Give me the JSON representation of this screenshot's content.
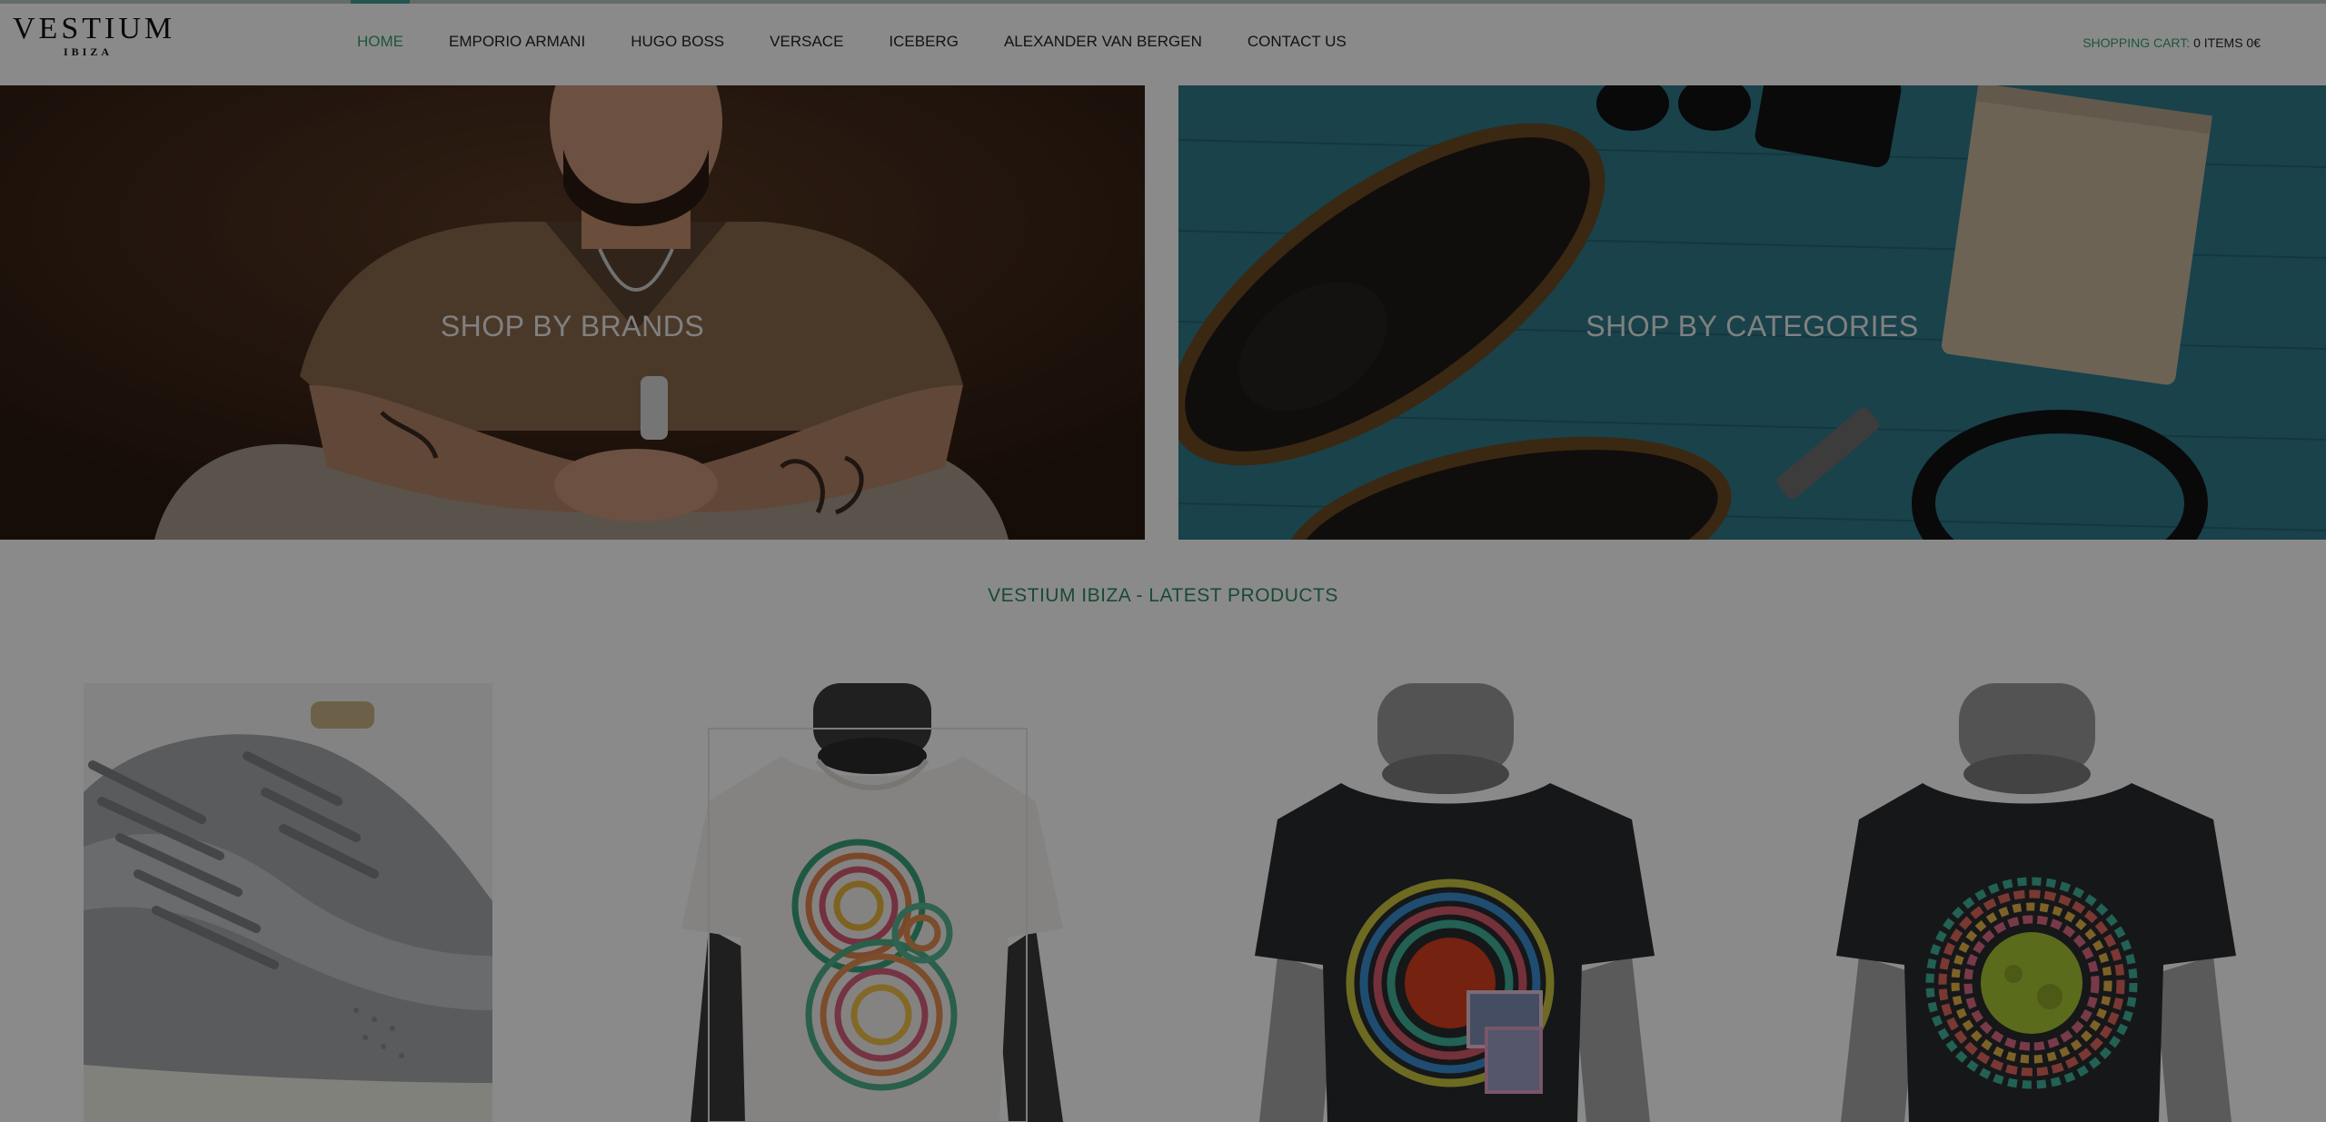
{
  "brand": {
    "name": "VESTIUM",
    "location": "IBIZA"
  },
  "nav": {
    "items": [
      {
        "label": "HOME",
        "active": true
      },
      {
        "label": "EMPORIO ARMANI",
        "active": false
      },
      {
        "label": "HUGO BOSS",
        "active": false
      },
      {
        "label": "VERSACE",
        "active": false
      },
      {
        "label": "ICEBERG",
        "active": false
      },
      {
        "label": "ALEXANDER VAN BERGEN",
        "active": false
      },
      {
        "label": "CONTACT US",
        "active": false
      }
    ]
  },
  "cart": {
    "label": "SHOPPING CART:",
    "value": "0 ITEMS 0€"
  },
  "hero": {
    "brands_label": "SHOP BY BRANDS",
    "categories_label": "SHOP BY CATEGORIES"
  },
  "latest": {
    "heading": "VESTIUM IBIZA - LATEST PRODUCTS"
  },
  "colors": {
    "accent": "#3aa06e",
    "heading_green": "#2e8a5e",
    "overlay": "rgba(0,0,0,0.46)"
  },
  "icons": {
    "products": [
      "grey-sneaker-image",
      "white-tshirt-image",
      "black-tshirt-circle-print-image",
      "black-tshirt-zigzag-print-image"
    ]
  }
}
